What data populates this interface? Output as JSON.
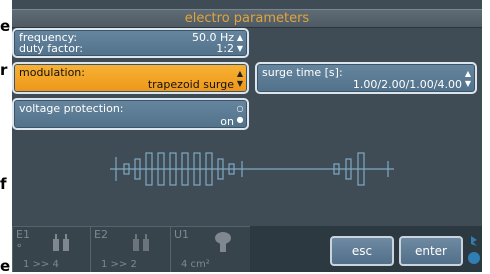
{
  "edge_left_text": [
    "e",
    "",
    "r",
    "",
    "",
    "",
    "",
    "",
    "",
    "f",
    "",
    "",
    "",
    "",
    "e"
  ],
  "header": {
    "title": "electro parameters"
  },
  "params": {
    "frequency": {
      "label": "frequency:",
      "value": "50.0 Hz"
    },
    "duty_factor": {
      "label": "duty factor:",
      "value": "1:2"
    },
    "modulation": {
      "label": "modulation:",
      "value": "trapezoid surge"
    },
    "surge_time": {
      "label": "surge time [s]:",
      "value": "1.00/2.00/1.00/4.00"
    },
    "voltage_protection": {
      "label": "voltage protection:",
      "value": "on"
    }
  },
  "tabs": [
    {
      "id": "E1",
      "value": "1 >> 4",
      "icon": "electrode-icon"
    },
    {
      "id": "E2",
      "value": "1 >> 2",
      "icon": "electrode-icon"
    },
    {
      "id": "U1",
      "value": "4 cm²",
      "icon": "ultrasound-head-icon"
    }
  ],
  "buttons": {
    "esc": "esc",
    "enter": "enter"
  },
  "colors": {
    "header_title": "#e2a33b",
    "active_panel": "#f3a324",
    "panel": "#5d7c94",
    "background": "#3f4c56"
  }
}
